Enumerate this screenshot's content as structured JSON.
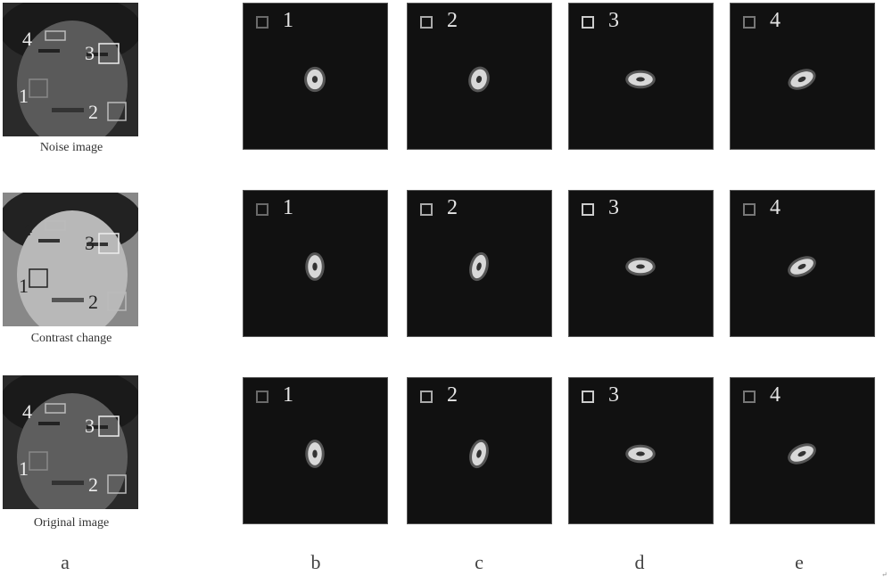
{
  "rows": [
    {
      "caption": "Noise image",
      "face_tone": "#5a5a5a",
      "region_labels": [
        "4",
        "3",
        "1",
        "2"
      ],
      "responses": [
        {
          "region": "1",
          "box_gray": "#6a6a6a",
          "aspect": 0.8,
          "angle_deg": 0
        },
        {
          "region": "2",
          "box_gray": "#aaaaaa",
          "aspect": 0.75,
          "angle_deg": 15
        },
        {
          "region": "3",
          "box_gray": "#cccccc",
          "aspect": 1.9,
          "angle_deg": 0
        },
        {
          "region": "4",
          "box_gray": "#777777",
          "aspect": 1.8,
          "angle_deg": -25
        }
      ]
    },
    {
      "caption": "Contrast change",
      "face_tone": "#b8b8b8",
      "region_labels": [
        "4",
        "3",
        "1",
        "2"
      ],
      "responses": [
        {
          "region": "1",
          "box_gray": "#6a6a6a",
          "aspect": 0.6,
          "angle_deg": 0
        },
        {
          "region": "2",
          "box_gray": "#aaaaaa",
          "aspect": 0.55,
          "angle_deg": 15
        },
        {
          "region": "3",
          "box_gray": "#cccccc",
          "aspect": 1.9,
          "angle_deg": 0
        },
        {
          "region": "4",
          "box_gray": "#777777",
          "aspect": 1.9,
          "angle_deg": -25
        }
      ]
    },
    {
      "caption": "Original image",
      "face_tone": "#5e5e5e",
      "region_labels": [
        "4",
        "3",
        "1",
        "2"
      ],
      "responses": [
        {
          "region": "1",
          "box_gray": "#6a6a6a",
          "aspect": 0.6,
          "angle_deg": 0
        },
        {
          "region": "2",
          "box_gray": "#aaaaaa",
          "aspect": 0.55,
          "angle_deg": 15
        },
        {
          "region": "3",
          "box_gray": "#cccccc",
          "aspect": 1.9,
          "angle_deg": 0
        },
        {
          "region": "4",
          "box_gray": "#777777",
          "aspect": 1.9,
          "angle_deg": -25
        }
      ]
    }
  ],
  "column_labels": [
    "a",
    "b",
    "c",
    "d",
    "e"
  ],
  "corner_mark": "↵"
}
